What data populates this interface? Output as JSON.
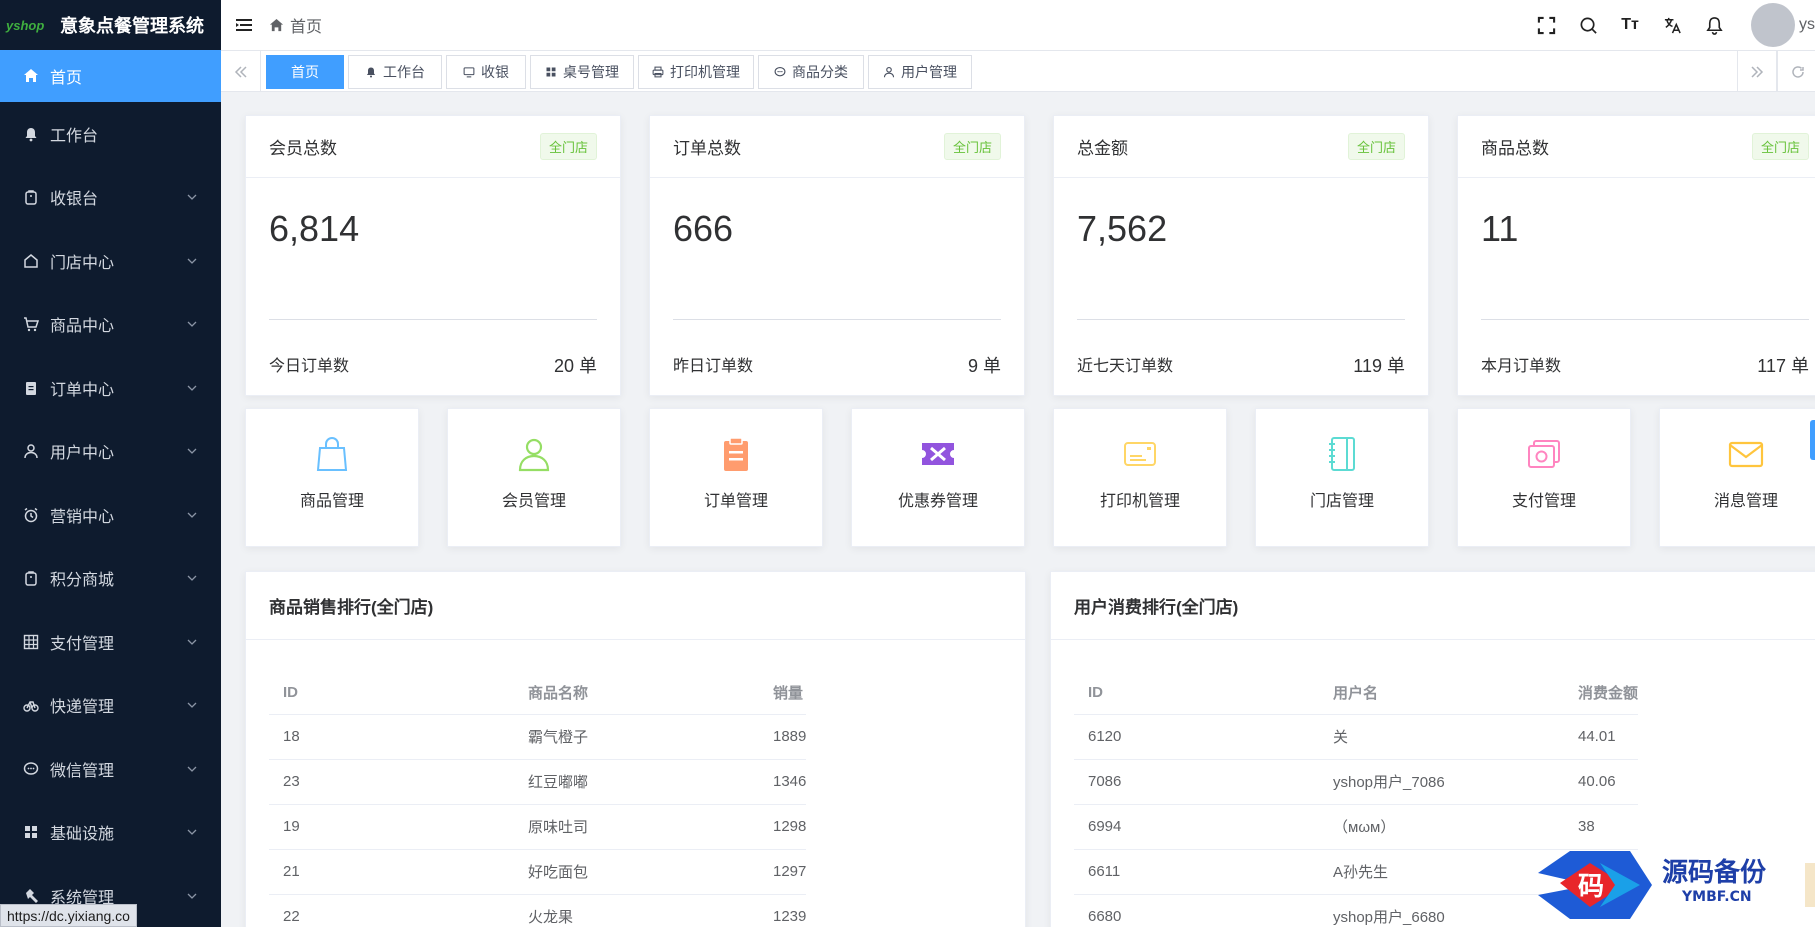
{
  "app": {
    "logo_text": "yshop",
    "title": "意象点餐管理系统"
  },
  "header": {
    "breadcrumb": "首页",
    "font_tool": "Tт",
    "user_name": "ys"
  },
  "sidebar": {
    "items": [
      {
        "label": "首页",
        "icon": "home-icon",
        "active": true
      },
      {
        "label": "工作台",
        "icon": "bell-icon"
      },
      {
        "label": "收银台",
        "icon": "bag-icon",
        "expandable": true
      },
      {
        "label": "门店中心",
        "icon": "house-icon",
        "expandable": true
      },
      {
        "label": "商品中心",
        "icon": "cart-icon",
        "expandable": true
      },
      {
        "label": "订单中心",
        "icon": "clipboard-icon",
        "expandable": true
      },
      {
        "label": "用户中心",
        "icon": "user-icon",
        "expandable": true
      },
      {
        "label": "营销中心",
        "icon": "alarm-icon",
        "expandable": true
      },
      {
        "label": "积分商城",
        "icon": "bag-icon",
        "expandable": true
      },
      {
        "label": "支付管理",
        "icon": "grid-table-icon",
        "expandable": true
      },
      {
        "label": "快递管理",
        "icon": "bike-icon",
        "expandable": true
      },
      {
        "label": "微信管理",
        "icon": "chat-icon",
        "expandable": true
      },
      {
        "label": "基础设施",
        "icon": "apps-icon",
        "expandable": true
      },
      {
        "label": "系统管理",
        "icon": "hammer-icon",
        "expandable": true
      }
    ]
  },
  "tags": [
    {
      "label": "首页",
      "icon": "",
      "active": true
    },
    {
      "label": "工作台",
      "icon": "bell-icon"
    },
    {
      "label": "收银",
      "icon": "monitor-icon"
    },
    {
      "label": "桌号管理",
      "icon": "apps-icon"
    },
    {
      "label": "打印机管理",
      "icon": "printer-icon"
    },
    {
      "label": "商品分类",
      "icon": "chat-icon"
    },
    {
      "label": "用户管理",
      "icon": "user-icon"
    }
  ],
  "stats": [
    {
      "title": "会员总数",
      "badge": "全门店",
      "value": "6,814",
      "foot_label": "今日订单数",
      "foot_value": "20 单"
    },
    {
      "title": "订单总数",
      "badge": "全门店",
      "value": "666",
      "foot_label": "昨日订单数",
      "foot_value": "9 单"
    },
    {
      "title": "总金额",
      "badge": "全门店",
      "value": "7,562",
      "foot_label": "近七天订单数",
      "foot_value": "119 单"
    },
    {
      "title": "商品总数",
      "badge": "全门店",
      "value": "11",
      "foot_label": "本月订单数",
      "foot_value": "117 单"
    }
  ],
  "quick": [
    {
      "label": "商品管理",
      "icon": "shopping-bag-icon",
      "color": "#69c0ff"
    },
    {
      "label": "会员管理",
      "icon": "member-icon",
      "color": "#95de64"
    },
    {
      "label": "订单管理",
      "icon": "order-clipboard-icon",
      "color": "#ff9c6e"
    },
    {
      "label": "优惠券管理",
      "icon": "coupon-icon",
      "color": "#9254de"
    },
    {
      "label": "打印机管理",
      "icon": "printer-card-icon",
      "color": "#ffd666"
    },
    {
      "label": "门店管理",
      "icon": "notebook-icon",
      "color": "#5cdbd3"
    },
    {
      "label": "支付管理",
      "icon": "payment-icon",
      "color": "#ff85c0"
    },
    {
      "label": "消息管理",
      "icon": "envelope-icon",
      "color": "#ffc53d"
    }
  ],
  "product_rank": {
    "title": "商品销售排行(全门店)",
    "headers": [
      "ID",
      "商品名称",
      "销量"
    ],
    "rows": [
      [
        "18",
        "霸气橙子",
        "1889"
      ],
      [
        "23",
        "红豆嘟嘟",
        "1346"
      ],
      [
        "19",
        "原味吐司",
        "1298"
      ],
      [
        "21",
        "好吃面包",
        "1297"
      ],
      [
        "22",
        "火龙果",
        "1239"
      ]
    ]
  },
  "user_rank": {
    "title": "用户消费排行(全门店)",
    "headers": [
      "ID",
      "用户名",
      "消费金额"
    ],
    "rows": [
      [
        "6120",
        "关",
        "44.01"
      ],
      [
        "7086",
        "yshop用户_7086",
        "40.06"
      ],
      [
        "6994",
        "（мωм）",
        "38"
      ],
      [
        "6611",
        "A孙先生",
        ""
      ],
      [
        "6680",
        "yshop用户_6680",
        ""
      ]
    ]
  },
  "status_url": "https://dc.yixiang.co",
  "watermark": {
    "main": "源码备份",
    "sub": "YMBF.CN",
    "logo_char": "码"
  }
}
